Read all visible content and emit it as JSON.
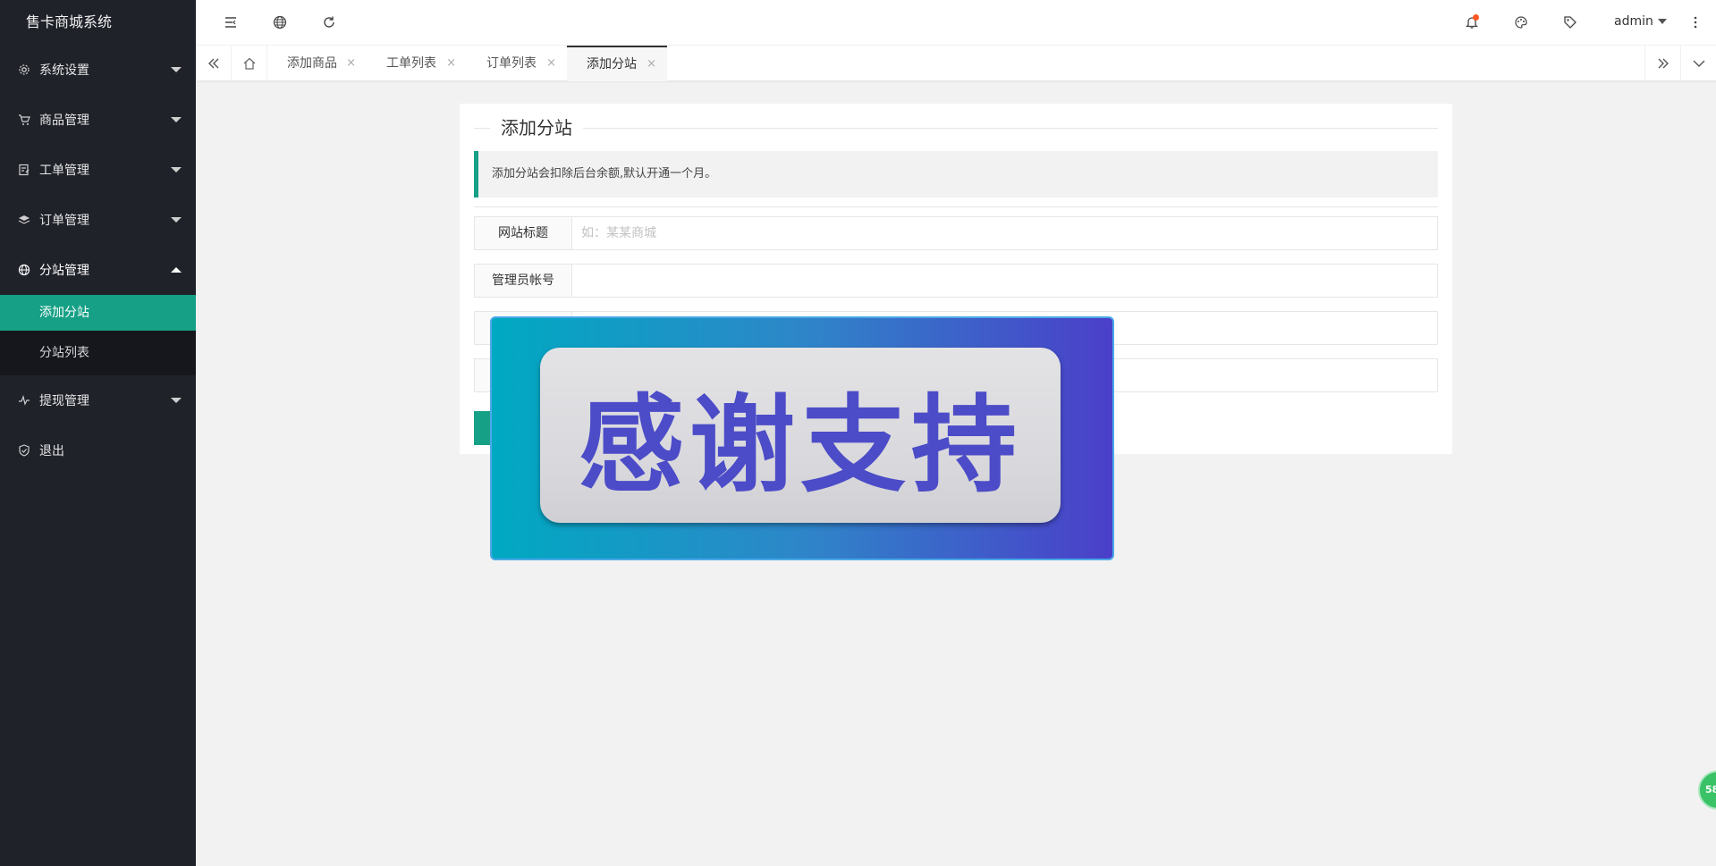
{
  "app": {
    "title": "售卡商城系统"
  },
  "sidebar": {
    "items": [
      {
        "label": "系统设置",
        "icon": "gear-icon"
      },
      {
        "label": "商品管理",
        "icon": "cart-icon"
      },
      {
        "label": "工单管理",
        "icon": "ticket-icon"
      },
      {
        "label": "订单管理",
        "icon": "layers-icon"
      },
      {
        "label": "分站管理",
        "icon": "globe-icon",
        "expanded": true,
        "children": [
          {
            "label": "添加分站",
            "active": true
          },
          {
            "label": "分站列表"
          }
        ]
      },
      {
        "label": "提现管理",
        "icon": "pulse-icon"
      },
      {
        "label": "退出",
        "icon": "shield-icon"
      }
    ]
  },
  "header": {
    "user": "admin",
    "icons": [
      "menu-fold-icon",
      "globe-icon",
      "refresh-icon",
      "bell-icon",
      "palette-icon",
      "tag-icon",
      "more-vertical-icon"
    ],
    "notification_dot_color": "#ff5722"
  },
  "tabs": [
    {
      "label": "添加商品",
      "close": "×"
    },
    {
      "label": "工单列表",
      "close": "×"
    },
    {
      "label": "订单列表",
      "close": "×"
    },
    {
      "label": "添加分站",
      "close": "×",
      "active": true
    }
  ],
  "form": {
    "title": "添加分站",
    "notice": "添加分站会扣除后台余额,默认开通一个月。",
    "fields": [
      {
        "label": "网站标题",
        "value": "",
        "placeholder": "如：某某商城"
      },
      {
        "label": "管理员帐号",
        "value": "",
        "placeholder": ""
      },
      {
        "label": "",
        "value": "",
        "placeholder": ""
      },
      {
        "label": "",
        "value": "",
        "placeholder": ""
      }
    ],
    "submit_label": ""
  },
  "overlay": {
    "text": "感谢支持"
  },
  "float_ball": {
    "text": "58"
  },
  "colors": {
    "accent": "#16a085",
    "sidebar_bg": "#20222a",
    "submenu_bg": "#15171d",
    "overlay_text": "#4c4cc8"
  }
}
